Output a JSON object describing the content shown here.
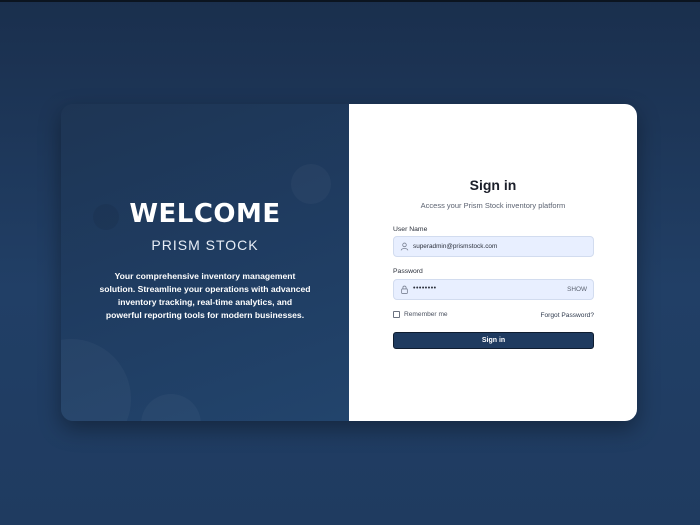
{
  "welcome": {
    "heading": "WELCOME",
    "brand": "PRISM STOCK",
    "description": "Your comprehensive inventory management solution. Streamline your operations with advanced inventory tracking, real-time analytics, and powerful reporting tools for modern businesses."
  },
  "signin": {
    "title": "Sign in",
    "subtitle": "Access your Prism Stock inventory platform",
    "username_label": "User Name",
    "username_value": "superadmin@prismstock.com",
    "password_label": "Password",
    "password_value": "••••••••",
    "show_label": "SHOW",
    "remember_label": "Remember me",
    "remember_checked": false,
    "forgot_label": "Forgot Password?",
    "button_label": "Sign in"
  },
  "icons": {
    "user": "user-icon",
    "lock": "lock-icon"
  },
  "colors": {
    "background": "#1f3b60",
    "panel_left": "#1f3c61",
    "button": "#1f3b60",
    "input_bg": "#e8efff"
  }
}
